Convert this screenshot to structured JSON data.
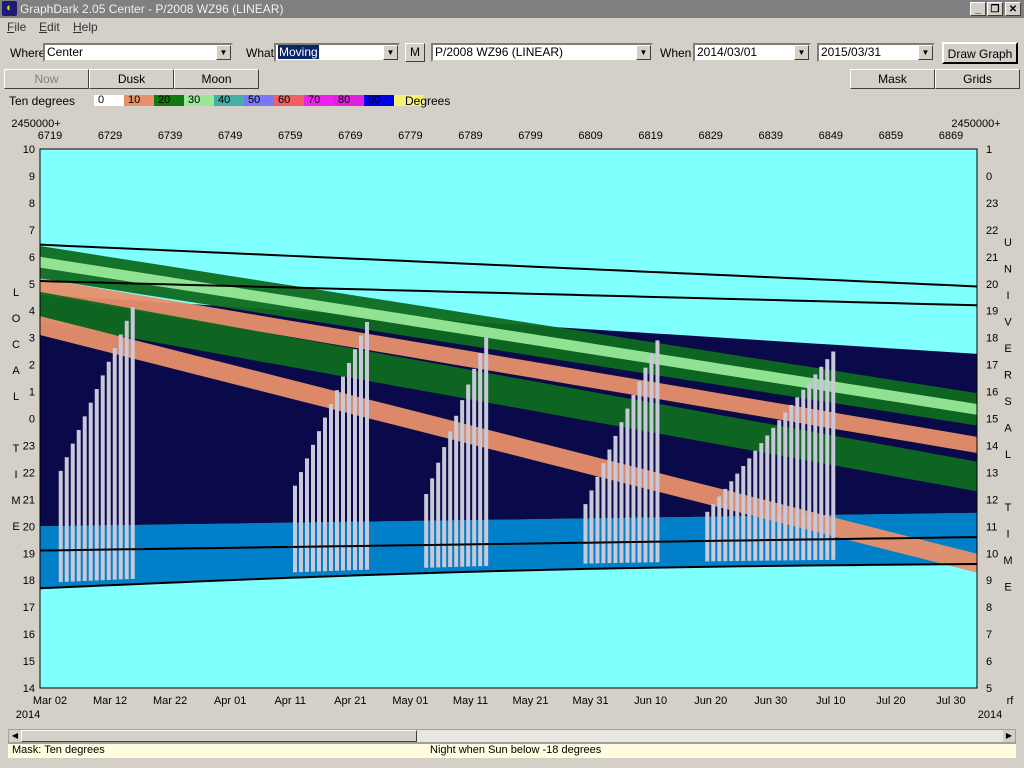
{
  "window": {
    "title": "GraphDark 2.05  Center  -  P/2008 WZ96 (LINEAR)",
    "app_icon": "owl-icon",
    "minimize": "_",
    "maximize": "🗗",
    "close": "✕"
  },
  "menu": [
    {
      "label": "File",
      "key": "F",
      "rest": "ile"
    },
    {
      "label": "Edit",
      "key": "E",
      "rest": "dit"
    },
    {
      "label": "Help",
      "key": "H",
      "rest": "elp"
    }
  ],
  "toolbar": {
    "where_label": "Where",
    "where_value": "Center",
    "what_label": "What",
    "what_value": "Moving",
    "m_button": "M",
    "object_value": "P/2008 WZ96 (LINEAR)",
    "when_label": "When",
    "start_date": "2014/03/01",
    "end_date": "2015/03/31",
    "draw_button": "Draw Graph"
  },
  "buttons": {
    "now": "Now",
    "dusk": "Dusk",
    "moon": "Moon",
    "mask": "Mask",
    "grids": "Grids"
  },
  "legend": {
    "label": "Ten degrees",
    "unit": "Degrees",
    "entries": [
      {
        "text": "0",
        "color": "#ffffff"
      },
      {
        "text": "10",
        "color": "#e8906a"
      },
      {
        "text": "20",
        "color": "#0f7a0f"
      },
      {
        "text": "30",
        "color": "#98e898"
      },
      {
        "text": "40",
        "color": "#40b0a8"
      },
      {
        "text": "50",
        "color": "#7878f8"
      },
      {
        "text": "60",
        "color": "#f06060"
      },
      {
        "text": "70",
        "color": "#f020f0"
      },
      {
        "text": "80",
        "color": "#e020e0"
      },
      {
        "text": "90",
        "color": "#0000f0"
      },
      {
        "text": "",
        "color": "#f8f070"
      }
    ]
  },
  "chart_data": {
    "type": "heatmap",
    "jd_offset_left": "2450000+",
    "jd_offset_right": "2450000+",
    "jd_ticks": [
      "6719",
      "6729",
      "6739",
      "6749",
      "6759",
      "6769",
      "6779",
      "6789",
      "6799",
      "6809",
      "6819",
      "6829",
      "6839",
      "6849",
      "6859",
      "6869"
    ],
    "date_ticks": [
      "Mar 02",
      "Mar 12",
      "Mar 22",
      "Apr 01",
      "Apr 11",
      "Apr 21",
      "May 01",
      "May 11",
      "May 21",
      "May 31",
      "Jun 10",
      "Jun 20",
      "Jun 30",
      "Jul 10",
      "Jul 20",
      "Jul 30"
    ],
    "date_tail": "rf",
    "year_left": "2014",
    "year_right": "2014",
    "left_axis": [
      "10",
      "9",
      "8",
      "7",
      "6",
      "5",
      "4",
      "3",
      "2",
      "1",
      "0",
      "23",
      "22",
      "21",
      "20",
      "19",
      "18",
      "17",
      "16",
      "15",
      "14"
    ],
    "right_axis": [
      "1",
      "0",
      "23",
      "22",
      "21",
      "20",
      "19",
      "18",
      "17",
      "16",
      "15",
      "14",
      "13",
      "12",
      "11",
      "10",
      "9",
      "8",
      "7",
      "6",
      "5"
    ],
    "left_title": [
      "L",
      "O",
      "C",
      "A",
      "L",
      "",
      "T",
      "I",
      "M",
      "E"
    ],
    "right_title": [
      "U",
      "N",
      "I",
      "V",
      "E",
      "R",
      "S",
      "A",
      "L",
      "",
      "T",
      "I",
      "M",
      "E"
    ],
    "colors": {
      "day": "#80ffff",
      "night": "#0a0a4a",
      "twilight": "#0080c8",
      "moon": "#c8c8d8",
      "alt10": "#e8906a",
      "alt20": "#0f6a1f",
      "alt30": "#98e898"
    }
  },
  "status": {
    "mask": "Mask:  Ten degrees",
    "night": "Night when Sun below -18 degrees"
  }
}
